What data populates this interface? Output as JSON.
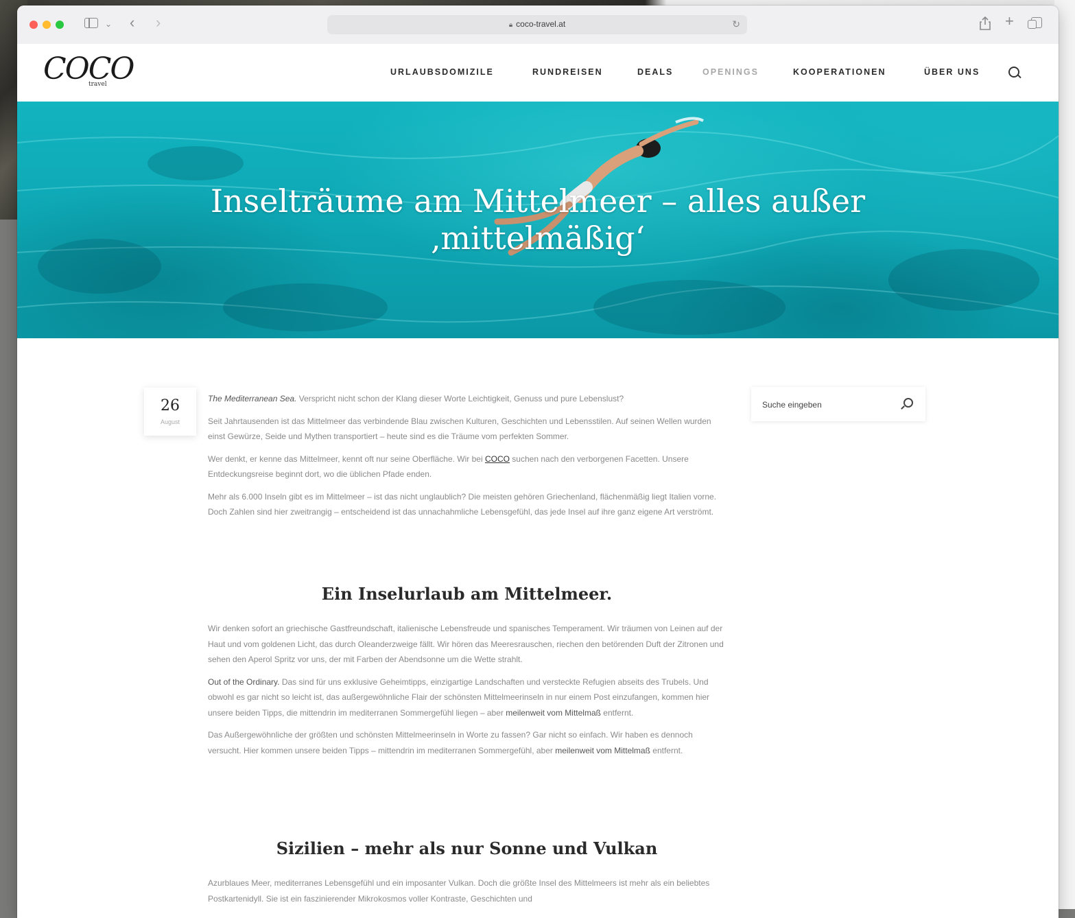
{
  "browser": {
    "url": "coco-travel.at"
  },
  "site": {
    "logo": "COCO",
    "logo_sub": "travel",
    "nav": [
      {
        "label": "URLAUBSDOMIZILE"
      },
      {
        "label": "RUNDREISEN"
      },
      {
        "label": "DEALS"
      },
      {
        "label": "OPENINGS"
      },
      {
        "label": "KOOPERATIONEN"
      },
      {
        "label": "ÜBER UNS"
      }
    ]
  },
  "hero": {
    "title_line1": "Inselträume am Mittelmeer – alles außer",
    "title_line2": "‚mittelmäßig‘"
  },
  "post": {
    "day": "26",
    "month": "August",
    "intro": {
      "lead": "The Mediterranean Sea.",
      "text": " Verspricht nicht schon der Klang dieser Worte Leichtigkeit, Genuss und pure Lebenslust?"
    },
    "p1": "Seit Jahrtausenden ist das Mittelmeer das verbindende Blau zwischen Kulturen, Geschichten und Lebensstilen. Auf seinen Wellen wurden einst Gewürze, Seide und Mythen transportiert – heute sind es die Träume vom perfekten Sommer.",
    "p2_before": "Wer denkt, er kenne das Mittelmeer, kennt oft nur seine Oberfläche. Wir bei ",
    "p2_link": "COCO",
    "p2_after": " suchen nach den verborgenen Facetten. Unsere Entdeckungsreise beginnt dort, wo die üblichen Pfade enden.",
    "p3": "Mehr als 6.000 Inseln gibt es im Mittelmeer – ist das nicht unglaublich? Die meisten gehören Griechenland, flächenmäßig liegt Italien vorne. Doch Zahlen sind hier zweitrangig – entscheidend ist das unnachahmliche Lebensgefühl, das jede Insel auf ihre ganz eigene Art verströmt.",
    "h2_1": "Ein Inselurlaub am Mittelmeer.",
    "p4": "Wir denken sofort an griechische Gastfreundschaft, italienische Lebensfreude und spanisches Temperament. Wir träumen von Leinen auf der Haut und vom goldenen Licht, das durch Oleanderzweige fällt. Wir hören das Meeresrauschen, riechen den betörenden Duft der Zitronen und sehen den Aperol Spritz vor uns, der mit Farben der Abendsonne um die Wette strahlt.",
    "p5_lead": "Out of the Ordinary.",
    "p5_text": " Das sind für uns exklusive Geheimtipps, einzigartige Landschaften und versteckte Refugien abseits des Trubels. Und obwohl es gar nicht so leicht ist, das außergewöhnliche Flair der schönsten Mittelmeerinseln in nur einem Post einzufangen, kommen hier unsere beiden Tipps, die mittendrin im mediterranen Sommergefühl liegen – aber ",
    "p5_bold": "meilenweit vom Mittelmaß",
    "p5_end": " entfernt.",
    "p6_text": "Das Außergewöhnliche der größten und schönsten Mittelmeerinseln in Worte zu fassen? Gar nicht so einfach. Wir haben es dennoch versucht. Hier kommen unsere beiden Tipps – mittendrin im mediterranen Sommergefühl, aber ",
    "p6_bold": "meilenweit vom Mittelmaß",
    "p6_end": " entfernt.",
    "h2_2": "Sizilien – mehr als nur Sonne und Vulkan",
    "p7": "Azurblaues Meer, mediterranes Lebensgefühl und ein imposanter Vulkan. Doch die größte Insel des Mittelmeers ist mehr als ein beliebtes Postkartenidyll. Sie ist ein faszinierender Mikrokosmos voller Kontraste, Geschichten und"
  },
  "sidebar": {
    "search_placeholder": "Suche eingeben"
  },
  "colors": {
    "hero_water": "#12b4c0",
    "nav_active_light": "#a7a7a7"
  },
  "icons": [
    "share-icon",
    "plus-icon",
    "tabs-icon",
    "search-icon",
    "sidebar-icon",
    "chevron-back-icon",
    "chevron-forward-icon",
    "reload-icon",
    "lock-icon"
  ]
}
